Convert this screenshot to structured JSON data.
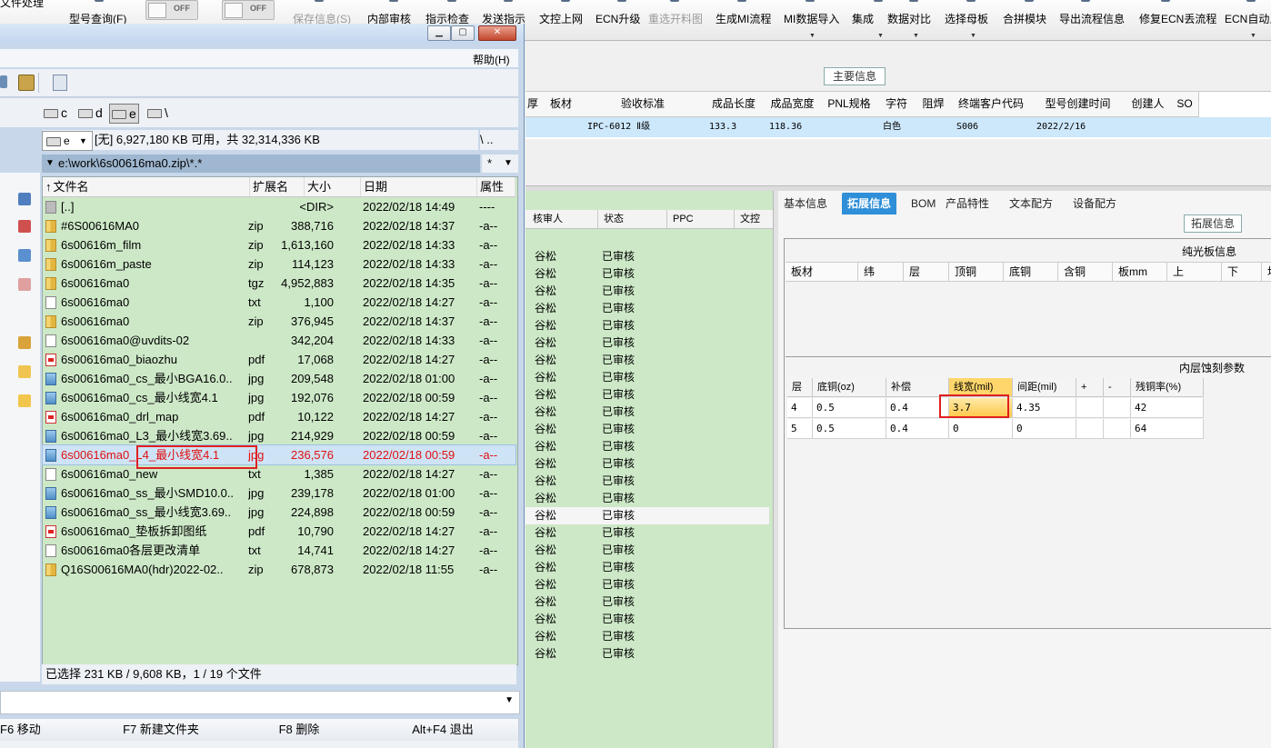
{
  "toolbar": {
    "left_cut": "文件处理",
    "items": [
      {
        "label": "型号查询(F)",
        "disabled": false,
        "dropdown": false
      },
      {
        "label": "保存信息(S)",
        "disabled": true,
        "dropdown": false
      },
      {
        "label": "内部审核",
        "disabled": false,
        "dropdown": false
      },
      {
        "label": "指示检查",
        "disabled": false,
        "dropdown": false
      },
      {
        "label": "发送指示",
        "disabled": false,
        "dropdown": false
      },
      {
        "label": "文控上网",
        "disabled": false,
        "dropdown": false
      },
      {
        "label": "ECN升级",
        "disabled": false,
        "dropdown": false
      },
      {
        "label": "重选开料图",
        "disabled": true,
        "dropdown": false
      },
      {
        "label": "生成MI流程",
        "disabled": false,
        "dropdown": false
      },
      {
        "label": "MI数据导入",
        "disabled": false,
        "dropdown": true
      },
      {
        "label": "集成",
        "disabled": false,
        "dropdown": true
      },
      {
        "label": "数据对比",
        "disabled": false,
        "dropdown": true
      },
      {
        "label": "选择母板",
        "disabled": false,
        "dropdown": true
      },
      {
        "label": "合拼模块",
        "disabled": false,
        "dropdown": false
      },
      {
        "label": "导出流程信息",
        "disabled": false,
        "dropdown": false
      },
      {
        "label": "修复ECN丢流程",
        "disabled": false,
        "dropdown": false
      },
      {
        "label": "ECN自动上",
        "disabled": false,
        "dropdown": true
      }
    ],
    "toggles": [
      "OFF",
      "OFF"
    ]
  },
  "main_info": {
    "title": "主要信息",
    "columns": [
      "厚",
      "板材",
      "验收标准",
      "成品长度",
      "成品宽度",
      "PNL规格",
      "字符",
      "阻焊",
      "终端客户代码",
      "型号创建时间",
      "创建人",
      "SO"
    ],
    "row": [
      "",
      "",
      "IPC-6012 Ⅱ级",
      "133.3",
      "118.36",
      "",
      "白色",
      "",
      "S006",
      "2022/2/16",
      "",
      ""
    ]
  },
  "review": {
    "columns": [
      "核审人",
      "状态",
      "PPC",
      "文控"
    ],
    "rows": [
      {
        "reviewer": "谷松",
        "status": "已审核"
      },
      {
        "reviewer": "谷松",
        "status": "已审核"
      },
      {
        "reviewer": "谷松",
        "status": "已审核"
      },
      {
        "reviewer": "谷松",
        "status": "已审核"
      },
      {
        "reviewer": "谷松",
        "status": "已审核"
      },
      {
        "reviewer": "谷松",
        "status": "已审核"
      },
      {
        "reviewer": "谷松",
        "status": "已审核"
      },
      {
        "reviewer": "谷松",
        "status": "已审核"
      },
      {
        "reviewer": "谷松",
        "status": "已审核"
      },
      {
        "reviewer": "谷松",
        "status": "已审核"
      },
      {
        "reviewer": "谷松",
        "status": "已审核"
      },
      {
        "reviewer": "谷松",
        "status": "已审核"
      },
      {
        "reviewer": "谷松",
        "status": "已审核"
      },
      {
        "reviewer": "谷松",
        "status": "已审核"
      },
      {
        "reviewer": "谷松",
        "status": "已审核"
      },
      {
        "reviewer": "谷松",
        "status": "已审核"
      },
      {
        "reviewer": "谷松",
        "status": "已审核"
      },
      {
        "reviewer": "谷松",
        "status": "已审核"
      },
      {
        "reviewer": "谷松",
        "status": "已审核"
      },
      {
        "reviewer": "谷松",
        "status": "已审核"
      },
      {
        "reviewer": "谷松",
        "status": "已审核"
      },
      {
        "reviewer": "谷松",
        "status": "已审核"
      },
      {
        "reviewer": "谷松",
        "status": "已审核"
      },
      {
        "reviewer": "谷松",
        "status": "已审核"
      }
    ],
    "selected_row": 15
  },
  "right": {
    "tabs": [
      "基本信息",
      "拓展信息",
      "BOM",
      "产品特性",
      "文本配方",
      "设备配方"
    ],
    "active_tab": 1,
    "ext_title": "拓展信息",
    "bare_board": {
      "title": "纯光板信息",
      "columns": [
        "板材",
        "纬",
        "层",
        "顶铜",
        "底铜",
        "含铜",
        "板mm",
        "上",
        "下",
        "均"
      ]
    },
    "inner_etch": {
      "title": "内层蚀刻参数",
      "columns": [
        "层",
        "底铜(oz)",
        "补偿",
        "线宽(mil)",
        "间距(mil)",
        "+",
        "-",
        "残铜率(%)"
      ],
      "rows": [
        [
          "4",
          "0.5",
          "0.4",
          "3.7",
          "4.35",
          "",
          "",
          "42"
        ],
        [
          "5",
          "0.5",
          "0.4",
          "0",
          "0",
          "",
          "",
          "64"
        ]
      ]
    }
  },
  "file_manager": {
    "menu_help": "帮助(H)",
    "drives": [
      "c",
      "d",
      "e",
      "\\"
    ],
    "active_drive": "e",
    "drive_select": "e",
    "drive_info": "[无] 6,927,180 KB 可用，共 32,314,336 KB",
    "drive_info_right": "\\  ..",
    "path": "e:\\work\\6s00616ma0.zip\\*.*",
    "path_filter": "*",
    "columns": [
      "文件名",
      "扩展名",
      "大小",
      "日期",
      "属性"
    ],
    "files": [
      {
        "icon": "up",
        "name": "[..]",
        "ext": "",
        "size": "<DIR>",
        "date": "2022/02/18 14:49",
        "attr": "----"
      },
      {
        "icon": "zip",
        "name": "#6S00616MA0",
        "ext": "zip",
        "size": "388,716",
        "date": "2022/02/18 14:37",
        "attr": "-a--"
      },
      {
        "icon": "zip",
        "name": "6s00616m_film",
        "ext": "zip",
        "size": "1,613,160",
        "date": "2022/02/18 14:33",
        "attr": "-a--"
      },
      {
        "icon": "zip",
        "name": "6s00616m_paste",
        "ext": "zip",
        "size": "114,123",
        "date": "2022/02/18 14:33",
        "attr": "-a--"
      },
      {
        "icon": "zip",
        "name": "6s00616ma0",
        "ext": "tgz",
        "size": "4,952,883",
        "date": "2022/02/18 14:35",
        "attr": "-a--"
      },
      {
        "icon": "file",
        "name": "6s00616ma0",
        "ext": "txt",
        "size": "1,100",
        "date": "2022/02/18 14:27",
        "attr": "-a--"
      },
      {
        "icon": "zip",
        "name": "6s00616ma0",
        "ext": "zip",
        "size": "376,945",
        "date": "2022/02/18 14:37",
        "attr": "-a--"
      },
      {
        "icon": "file",
        "name": "6s00616ma0@uvdits-02",
        "ext": "",
        "size": "342,204",
        "date": "2022/02/18 14:33",
        "attr": "-a--"
      },
      {
        "icon": "pdf",
        "name": "6s00616ma0_biaozhu",
        "ext": "pdf",
        "size": "17,068",
        "date": "2022/02/18 14:27",
        "attr": "-a--"
      },
      {
        "icon": "img",
        "name": "6s00616ma0_cs_最小BGA16.0..",
        "ext": "jpg",
        "size": "209,548",
        "date": "2022/02/18 01:00",
        "attr": "-a--"
      },
      {
        "icon": "img",
        "name": "6s00616ma0_cs_最小线宽4.1",
        "ext": "jpg",
        "size": "192,076",
        "date": "2022/02/18 00:59",
        "attr": "-a--"
      },
      {
        "icon": "pdf",
        "name": "6s00616ma0_drl_map",
        "ext": "pdf",
        "size": "10,122",
        "date": "2022/02/18 14:27",
        "attr": "-a--"
      },
      {
        "icon": "img",
        "name": "6s00616ma0_L3_最小线宽3.69..",
        "ext": "jpg",
        "size": "214,929",
        "date": "2022/02/18 00:59",
        "attr": "-a--"
      },
      {
        "icon": "img",
        "name": "6s00616ma0_L4_最小线宽4.1",
        "ext": "jpg",
        "size": "236,576",
        "date": "2022/02/18 00:59",
        "attr": "-a--"
      },
      {
        "icon": "file",
        "name": "6s00616ma0_new",
        "ext": "txt",
        "size": "1,385",
        "date": "2022/02/18 14:27",
        "attr": "-a--"
      },
      {
        "icon": "img",
        "name": "6s00616ma0_ss_最小SMD10.0..",
        "ext": "jpg",
        "size": "239,178",
        "date": "2022/02/18 01:00",
        "attr": "-a--"
      },
      {
        "icon": "img",
        "name": "6s00616ma0_ss_最小线宽3.69..",
        "ext": "jpg",
        "size": "224,898",
        "date": "2022/02/18 00:59",
        "attr": "-a--"
      },
      {
        "icon": "pdf",
        "name": "6s00616ma0_垫板拆卸图纸",
        "ext": "pdf",
        "size": "10,790",
        "date": "2022/02/18 14:27",
        "attr": "-a--"
      },
      {
        "icon": "file",
        "name": "6s00616ma0各层更改清单",
        "ext": "txt",
        "size": "14,741",
        "date": "2022/02/18 14:27",
        "attr": "-a--"
      },
      {
        "icon": "zip",
        "name": "Q16S00616MA0(hdr)2022-02..",
        "ext": "zip",
        "size": "678,873",
        "date": "2022/02/18 11:55",
        "attr": "-a--"
      }
    ],
    "selected_index": 13,
    "status": "已选择 231 KB / 9,608 KB，1 / 19 个文件",
    "fkeys": [
      "F6 移动",
      "F7 新建文件夹",
      "F8 删除",
      "Alt+F4 退出"
    ]
  },
  "colors": {
    "list_bg": "#cde8c7",
    "selection_red": "#e01010",
    "tab_active": "#2f8fd8",
    "highlight_box": "#e02020"
  }
}
